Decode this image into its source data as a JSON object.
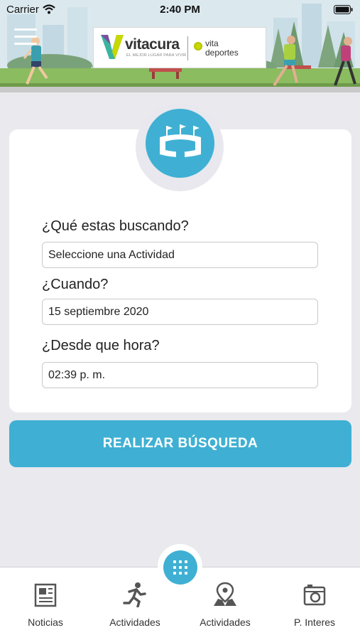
{
  "status_bar": {
    "carrier": "Carrier",
    "time": "2:40 PM"
  },
  "header": {
    "logo_name": "vitacura",
    "logo_tagline": "EL MEJOR LUGAR PARA VIVIR",
    "partner_line1": "vita",
    "partner_line2": "deportes"
  },
  "form": {
    "q_activity": "¿Qué estas buscando?",
    "activity_value": "Seleccione una Actividad",
    "q_date": "¿Cuando?",
    "date_value": "15 septiembre 2020",
    "q_time": "¿Desde que hora?",
    "time_value": "02:39 p. m."
  },
  "search_button": "REALIZAR BÚSQUEDA",
  "tabs": [
    {
      "label": "Noticias",
      "icon": "newspaper-icon"
    },
    {
      "label": "Actividades",
      "icon": "running-person-icon"
    },
    {
      "label": "Actividades",
      "icon": "map-pin-icon"
    },
    {
      "label": "P. Interes",
      "icon": "camera-icon"
    }
  ],
  "colors": {
    "accent": "#3fb0d3",
    "background": "#e9e9ee"
  }
}
